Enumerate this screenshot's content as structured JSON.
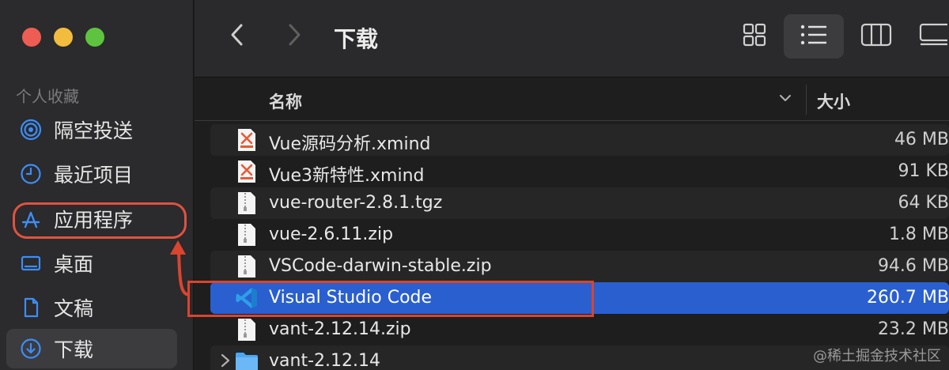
{
  "sidebar": {
    "section_title": "个人收藏",
    "items": [
      {
        "label": "隔空投送",
        "icon": "airdrop-icon"
      },
      {
        "label": "最近项目",
        "icon": "clock-icon"
      },
      {
        "label": "应用程序",
        "icon": "applications-icon"
      },
      {
        "label": "桌面",
        "icon": "desktop-icon"
      },
      {
        "label": "文稿",
        "icon": "document-icon"
      },
      {
        "label": "下载",
        "icon": "download-icon"
      }
    ],
    "active": "下载"
  },
  "toolbar": {
    "title": "下载",
    "back_icon": "chevron-left-icon",
    "forward_icon": "chevron-right-icon",
    "view_modes": [
      "icon-view",
      "list-view",
      "column-view",
      "gallery-view"
    ],
    "selected_view": "list-view"
  },
  "columns": {
    "name": "名称",
    "size": "大小"
  },
  "files": [
    {
      "name": "Vue源码分析.xmind",
      "size": "46 MB",
      "icon": "xmind-file-icon"
    },
    {
      "name": "Vue3新特性.xmind",
      "size": "91 KB",
      "icon": "xmind-file-icon"
    },
    {
      "name": "vue-router-2.8.1.tgz",
      "size": "64 KB",
      "icon": "archive-file-icon"
    },
    {
      "name": "vue-2.6.11.zip",
      "size": "1.8 MB",
      "icon": "zip-file-icon"
    },
    {
      "name": "VSCode-darwin-stable.zip",
      "size": "94.6 MB",
      "icon": "zip-file-icon"
    },
    {
      "name": "Visual Studio Code",
      "size": "260.7 MB",
      "icon": "vscode-app-icon",
      "selected": true
    },
    {
      "name": "vant-2.12.14.zip",
      "size": "23.2 MB",
      "icon": "zip-file-icon"
    },
    {
      "name": "vant-2.12.14",
      "size": "",
      "icon": "folder-icon"
    }
  ],
  "watermark": "@稀土掘金技术社区",
  "colors": {
    "selection": "#2a5fd0",
    "annotation": "#d9452f",
    "sidebar_accent": "#3d8ef7"
  }
}
